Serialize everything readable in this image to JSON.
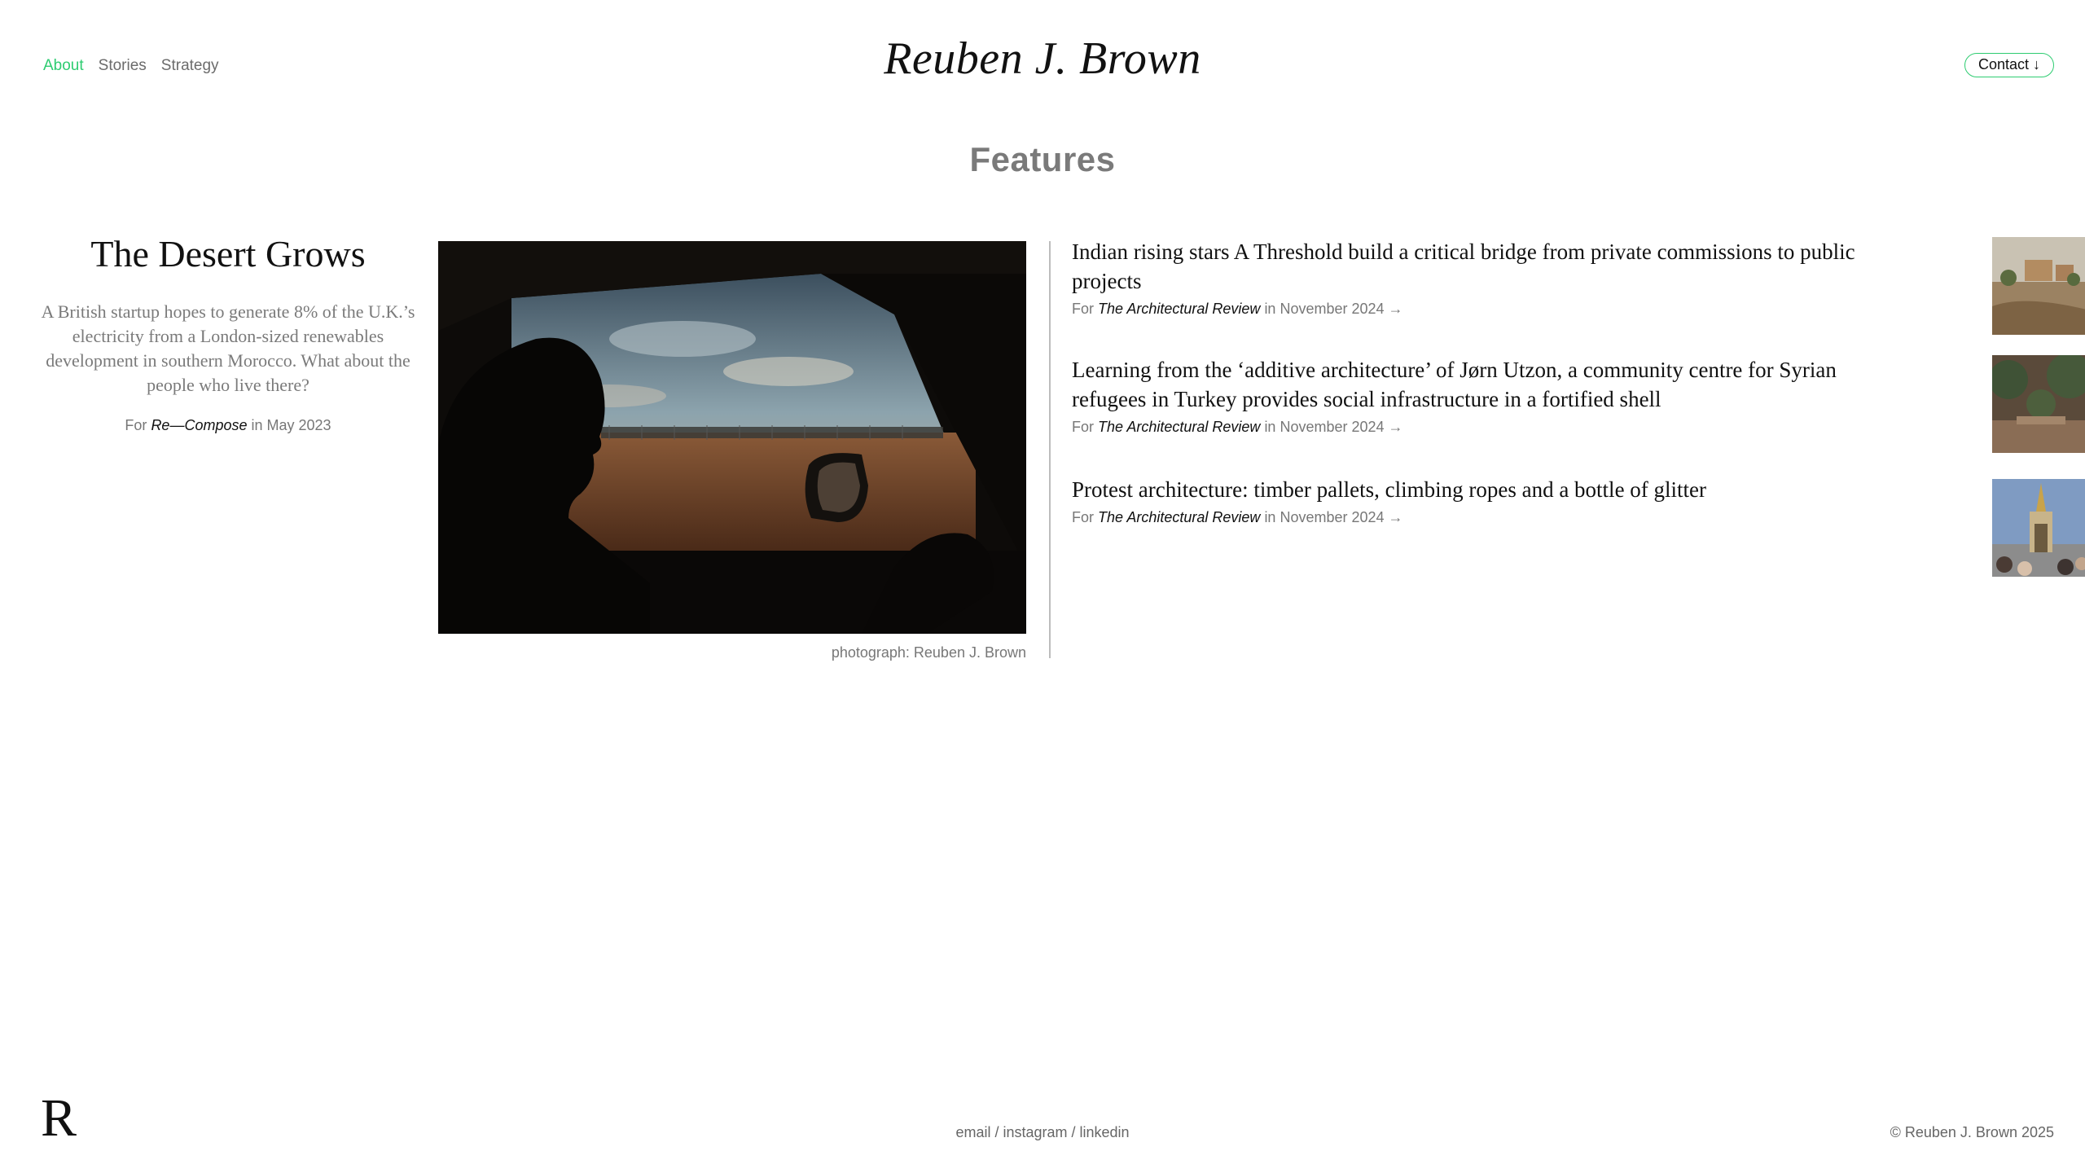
{
  "nav": {
    "items": [
      {
        "label": "About",
        "active": true
      },
      {
        "label": "Stories",
        "active": false
      },
      {
        "label": "Strategy",
        "active": false
      }
    ]
  },
  "site_title": "Reuben J. Brown",
  "contact_label": "Contact ↓",
  "section_title": "Features",
  "featured": {
    "title": "The Desert Grows",
    "description": "A British startup hopes to generate 8% of the U.K.’s electricity from a London-sized renewables development in southern Morocco. What about the people who live there?",
    "byline_prefix": "For",
    "publication": "Re—Compose",
    "byline_suffix": "in May 2023",
    "photo_caption": "photograph: Reuben J. Brown"
  },
  "stories": [
    {
      "title": "Indian rising stars A Threshold build a critical bridge from private commissions to public projects",
      "byline_prefix": "For",
      "publication": "The Architectural Review",
      "byline_suffix": "in November 2024 →"
    },
    {
      "title": "Learning from the ‘additive architecture’ of Jørn Utzon, a community centre for Syrian refugees in Turkey provides social infrastructure in a fortified shell",
      "byline_prefix": "For",
      "publication": "The Architectural Review",
      "byline_suffix": "in November 2024 →"
    },
    {
      "title": "Protest architecture: timber pallets, climbing ropes and a bottle of glitter",
      "byline_prefix": "For",
      "publication": "The Architectural Review",
      "byline_suffix": "in November 2024 →"
    }
  ],
  "footer": {
    "logo": "R",
    "links": [
      "email",
      "instagram",
      "linkedin"
    ],
    "separator": " / ",
    "copyright": "© Reuben J. Brown 2025"
  },
  "colors": {
    "accent": "#2ecc71",
    "muted_text": "#7a7a7a"
  }
}
